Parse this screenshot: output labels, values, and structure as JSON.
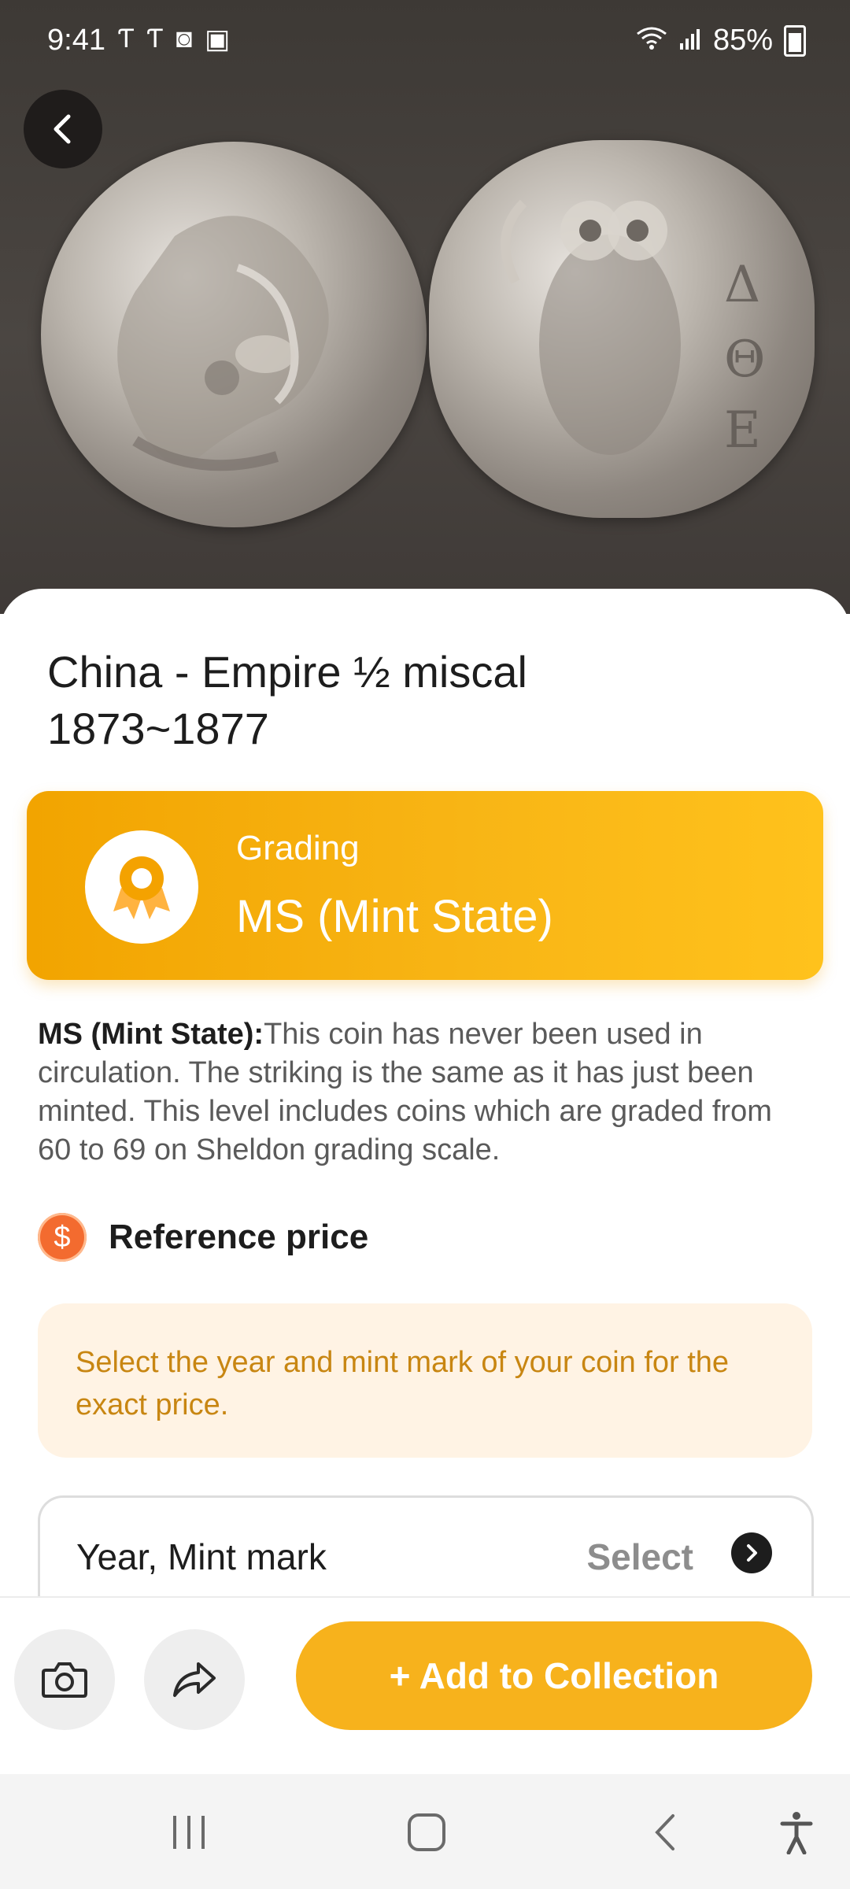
{
  "status_bar": {
    "time": "9:41",
    "battery": "85%",
    "left_icons": [
      "carrier-icon",
      "carrier-icon",
      "alarm-icon",
      "image-icon"
    ],
    "right_icons": [
      "wifi-icon",
      "signal-icon",
      "battery-charging-icon"
    ]
  },
  "coin": {
    "title": "China - Empire ½ miscal 1873~1877"
  },
  "grading": {
    "label": "Grading",
    "value": "MS (Mint State)",
    "icon": "award-medal-icon",
    "accent_start": "#f2a400",
    "accent_end": "#ffc21c"
  },
  "description": {
    "strong": "MS (Mint State):",
    "text": "This coin has never been used in circulation. The striking is the same as it has just been minted. This level includes coins which are graded from 60 to 69 on Sheldon grading scale."
  },
  "reference_price": {
    "label": "Reference price",
    "icon": "dollar-icon",
    "notice": "Select the year and mint mark of your coin for the exact price."
  },
  "year_mint": {
    "label": "Year, Mint mark",
    "select": "Select"
  },
  "actions": {
    "add_label": "+ Add to Collection",
    "camera_icon": "camera-icon",
    "share_icon": "share-icon"
  },
  "system_nav": [
    "recent-apps-icon",
    "home-icon",
    "back-icon",
    "accessibility-icon"
  ],
  "colors": {
    "primary": "#f7b21c",
    "notice_bg": "#fff3e4",
    "notice_text": "#c88612",
    "dollar": "#f36b2f"
  }
}
